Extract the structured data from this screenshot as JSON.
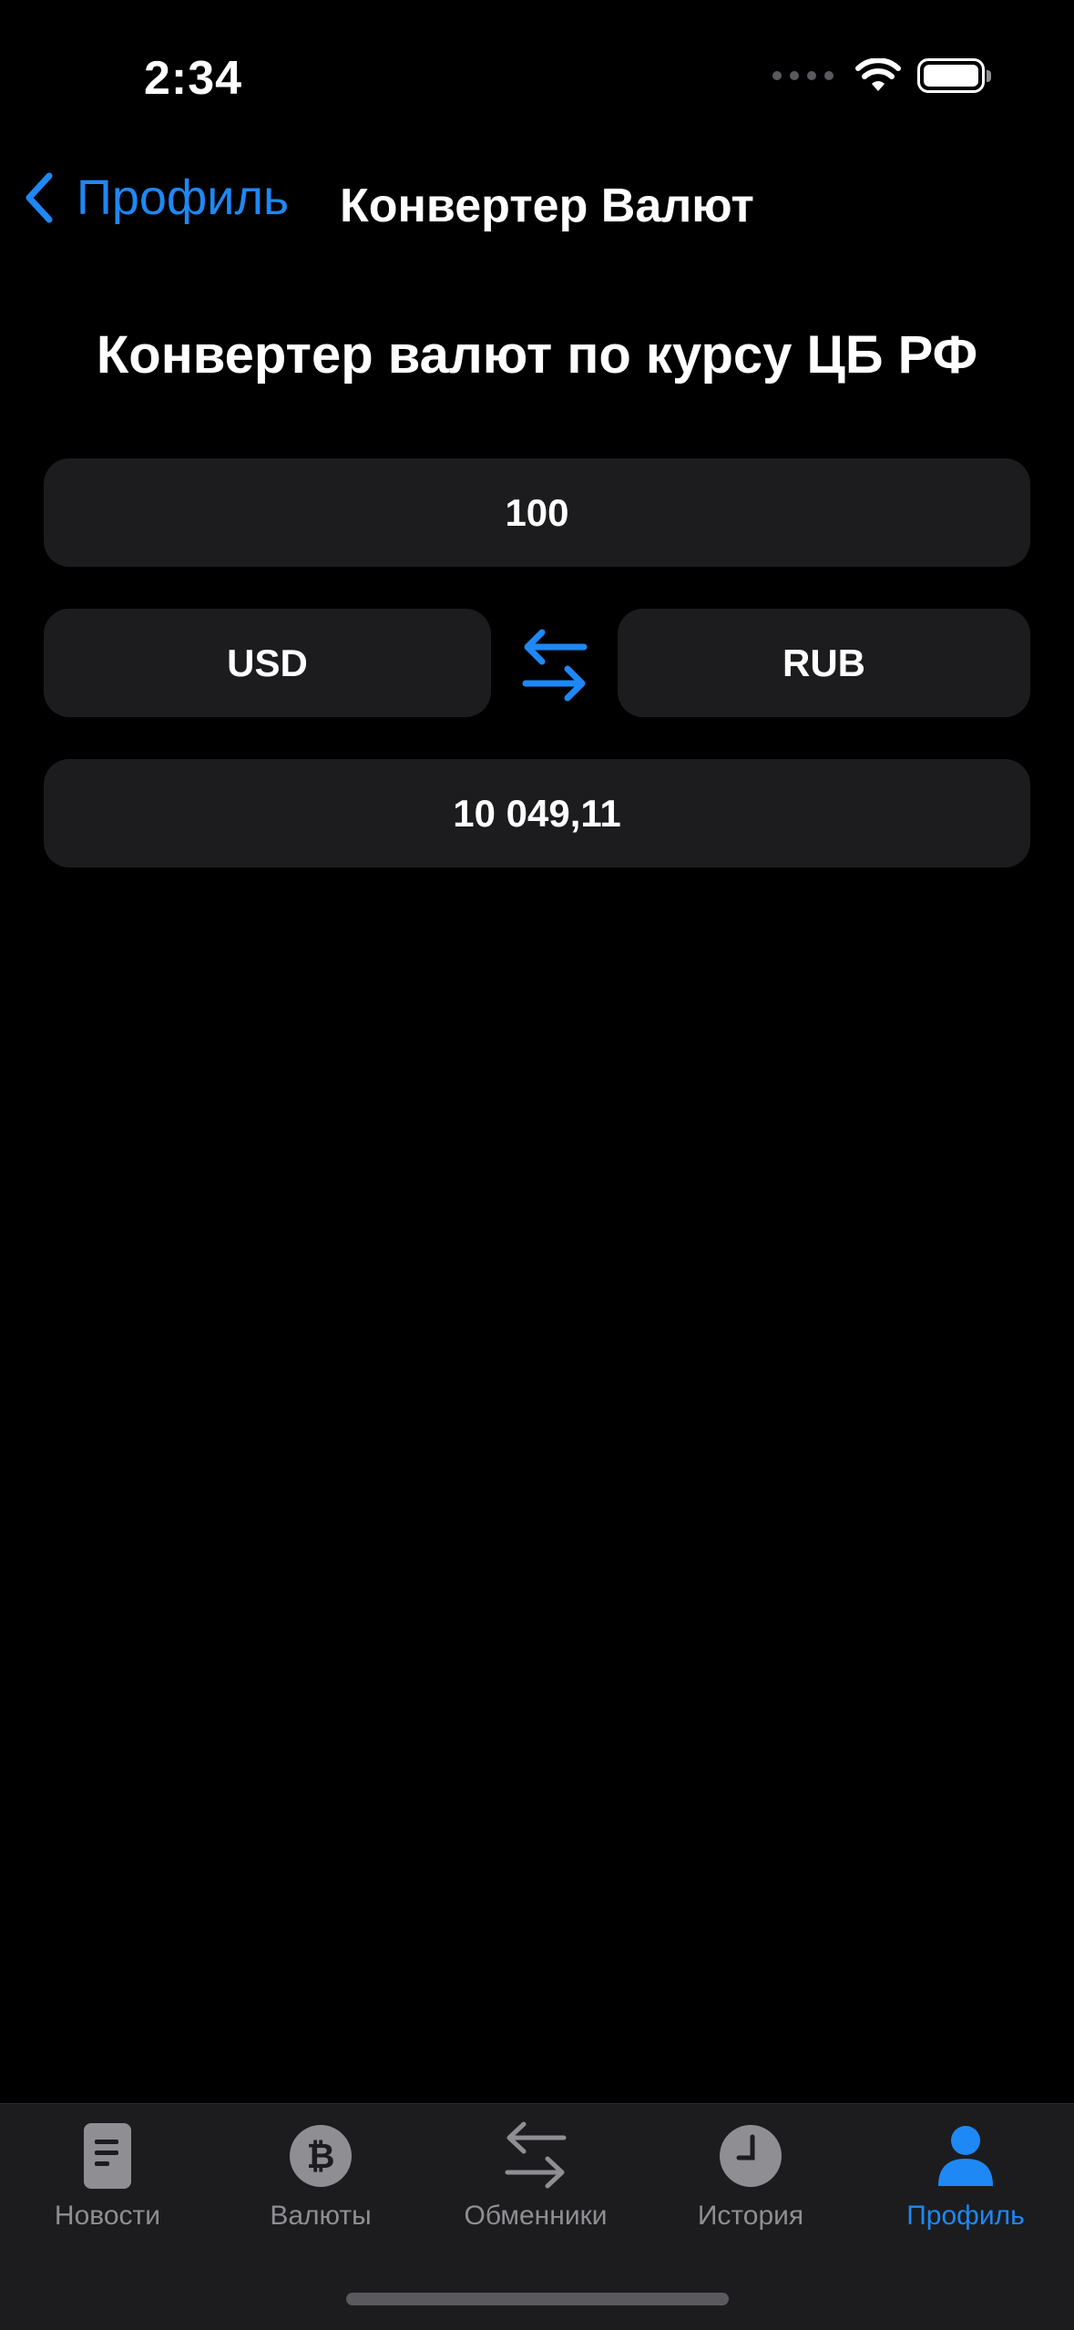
{
  "status_bar": {
    "time": "2:34"
  },
  "nav": {
    "back_label": "Профиль",
    "title": "Конвертер Валют"
  },
  "converter": {
    "heading": "Конвертер валют по курсу ЦБ РФ",
    "amount": "100",
    "from_currency": "USD",
    "to_currency": "RUB",
    "result": "10 049,11"
  },
  "tab_bar": {
    "tabs": [
      {
        "label": "Новости",
        "icon": "news-icon",
        "active": false
      },
      {
        "label": "Валюты",
        "icon": "bitcoin-icon",
        "active": false
      },
      {
        "label": "Обменники",
        "icon": "exchange-arrows-icon",
        "active": false
      },
      {
        "label": "История",
        "icon": "clock-icon",
        "active": false
      },
      {
        "label": "Профиль",
        "icon": "person-icon",
        "active": true
      }
    ]
  },
  "colors": {
    "accent": "#1e88f5",
    "background": "#000000",
    "field": "#1c1c1e",
    "inactive": "#8e8e93"
  }
}
